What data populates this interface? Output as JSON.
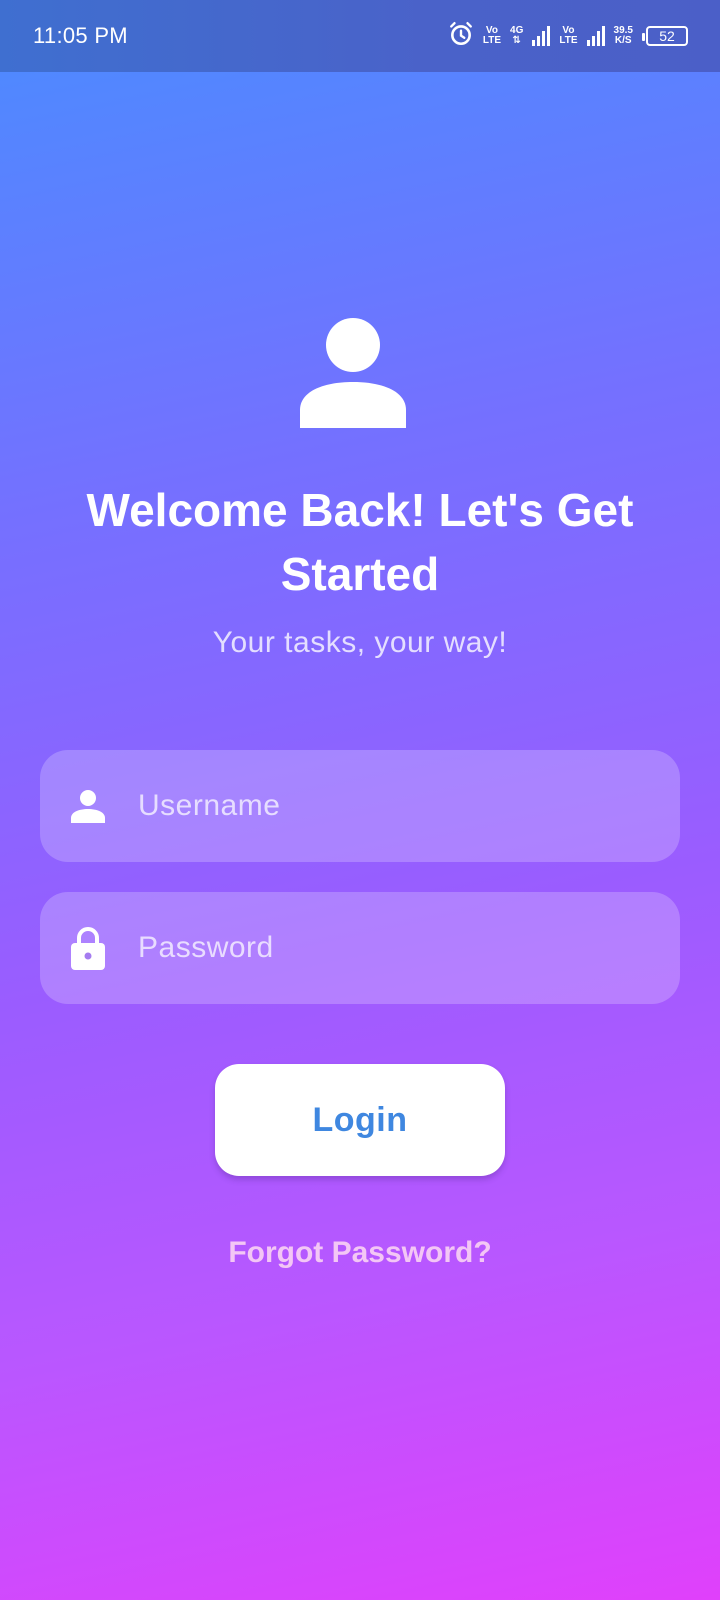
{
  "status_bar": {
    "time": "11:05 PM",
    "sim1_volte_top": "Vo",
    "sim1_volte_bottom": "LTE",
    "network_type": "4G",
    "sim2_volte_top": "Vo",
    "sim2_volte_bottom": "LTE",
    "speed_value": "39.5",
    "speed_unit": "K/S",
    "battery": "52",
    "icons": [
      "alarm-icon",
      "signal-icon",
      "battery-icon"
    ]
  },
  "header": {
    "avatar_icon": "person-icon",
    "title": "Welcome Back! Let's Get Started",
    "subtitle": "Your tasks, your way!"
  },
  "form": {
    "username": {
      "icon": "person-icon",
      "placeholder": "Username",
      "value": ""
    },
    "password": {
      "icon": "lock-icon",
      "placeholder": "Password",
      "value": ""
    },
    "login_label": "Login",
    "forgot_label": "Forgot Password?"
  },
  "colors": {
    "gradient_top": "#4a8cff",
    "gradient_bottom": "#e040fb",
    "login_text": "#3f87e0",
    "forgot_text": "#f3c6f5"
  }
}
